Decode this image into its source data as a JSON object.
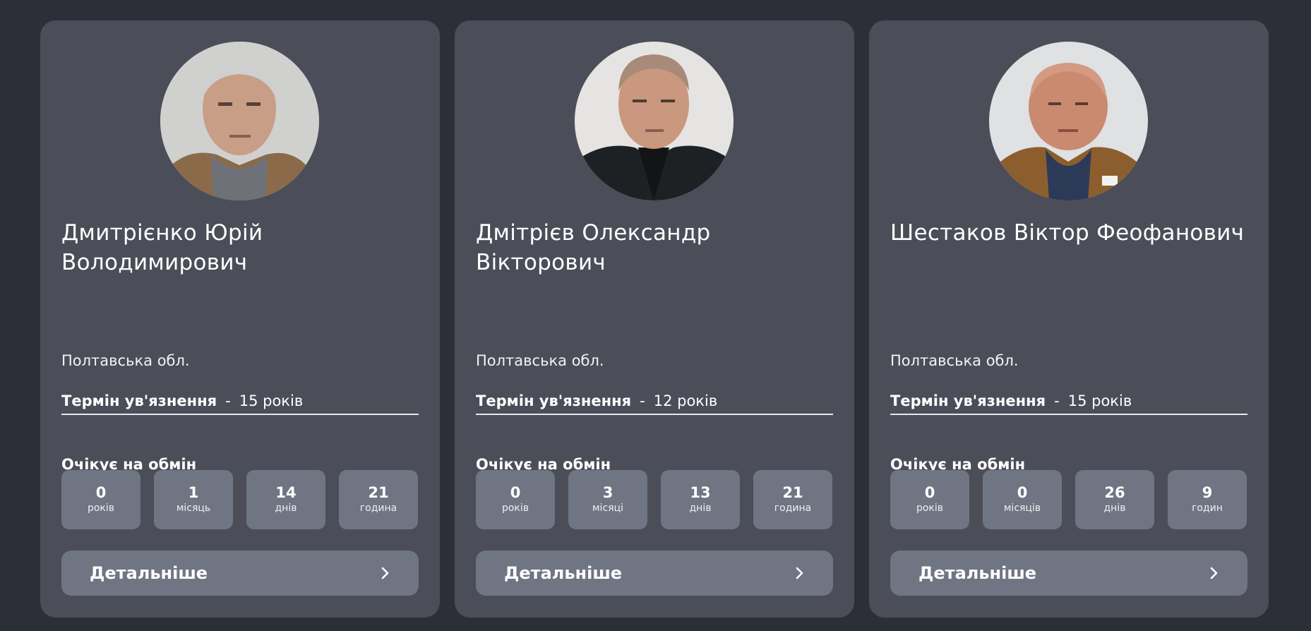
{
  "cards": [
    {
      "name": "Дмитрієнко Юрій Володимирович",
      "region": "Полтавська обл.",
      "term_label": "Термін ув'язнення",
      "term_separator": "-",
      "term_value": "15 років",
      "awaits_label": "Очікує на обмін",
      "counters": [
        {
          "value": "0",
          "unit": "років"
        },
        {
          "value": "1",
          "unit": "місяць"
        },
        {
          "value": "14",
          "unit": "днів"
        },
        {
          "value": "21",
          "unit": "година"
        }
      ],
      "button_label": "Детальніше",
      "button_icon": "chevron-right-icon"
    },
    {
      "name": "Дмітрієв Олександр Вікторович",
      "region": "Полтавська обл.",
      "term_label": "Термін ув'язнення",
      "term_separator": "-",
      "term_value": "12 років",
      "awaits_label": "Очікує на обмін",
      "counters": [
        {
          "value": "0",
          "unit": "років"
        },
        {
          "value": "3",
          "unit": "місяці"
        },
        {
          "value": "13",
          "unit": "днів"
        },
        {
          "value": "21",
          "unit": "година"
        }
      ],
      "button_label": "Детальніше",
      "button_icon": "chevron-right-icon"
    },
    {
      "name": "Шестаков Віктор Феофанович",
      "region": "Полтавська обл.",
      "term_label": "Термін ув'язнення",
      "term_separator": "-",
      "term_value": "15 років",
      "awaits_label": "Очікує на обмін",
      "counters": [
        {
          "value": "0",
          "unit": "років"
        },
        {
          "value": "0",
          "unit": "місяців"
        },
        {
          "value": "26",
          "unit": "днів"
        },
        {
          "value": "9",
          "unit": "годин"
        }
      ],
      "button_label": "Детальніше",
      "button_icon": "chevron-right-icon"
    }
  ],
  "colors": {
    "page_background": "#2c2f37",
    "card_background": "#4b4e58",
    "tile_background": "#707584",
    "text": "#ffffff"
  }
}
